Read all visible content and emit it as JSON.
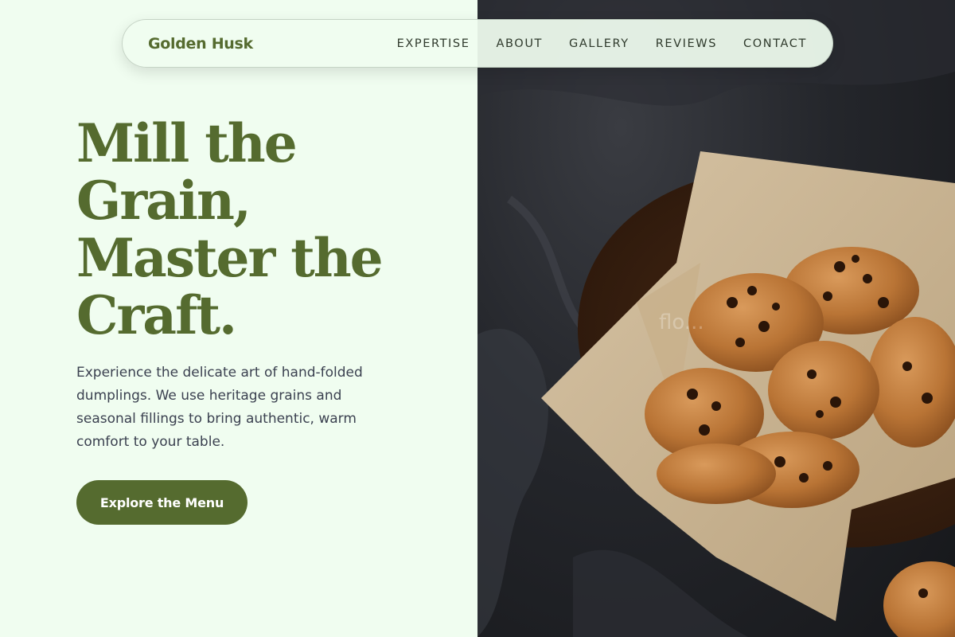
{
  "brand": {
    "name": "Golden Husk"
  },
  "nav": {
    "links": [
      "EXPERTISE",
      "ABOUT",
      "GALLERY",
      "REVIEWS",
      "CONTACT"
    ]
  },
  "hero": {
    "headline_lines": [
      "Mill the",
      "Grain,",
      "Master the",
      "Craft."
    ],
    "subcopy": "Experience the delicate art of hand-folded dumplings. We use heritage grains and seasonal fillings to bring authentic, warm comfort to your table.",
    "cta_label": "Explore the Menu",
    "image": {
      "subject": "cookies-in-bowl-image",
      "watermark": "flo..."
    }
  },
  "colors": {
    "page_bg": "#f0fdf0",
    "accent": "#556b2f",
    "body_text": "#3b4150",
    "nav_text": "#2f3a2c"
  }
}
